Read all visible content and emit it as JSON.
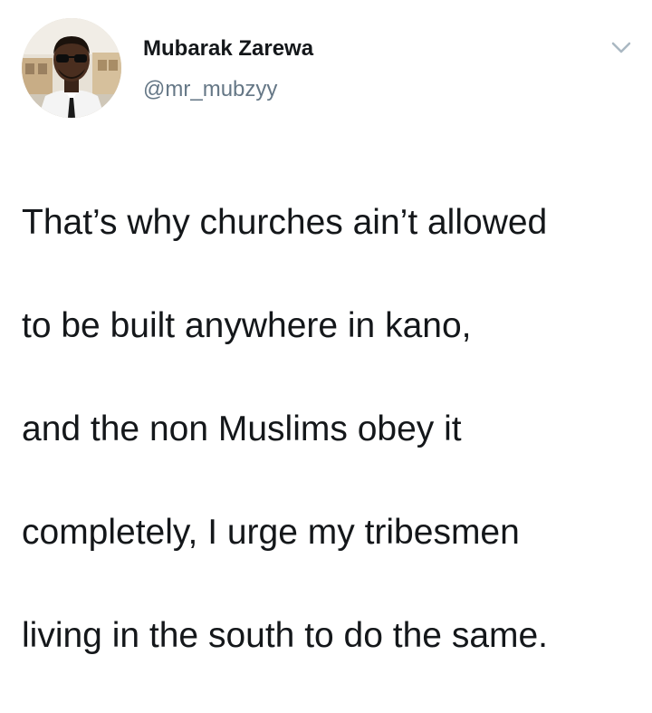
{
  "tweet": {
    "author": {
      "display_name": "Mubarak Zarewa",
      "handle": "@mr_mubzyy",
      "avatar_icon": "profile-photo"
    },
    "menu_icon": "chevron-down-icon",
    "text_lines": [
      "That’s why churches ain’t allowed",
      "to be built anywhere in kano,",
      "and the non Muslims obey it",
      "completely, I urge my tribesmen",
      "living in the south to do the same."
    ]
  },
  "colors": {
    "text": "#14171a",
    "secondary_text": "#657786",
    "caret": "#aab8c2",
    "background": "#ffffff"
  }
}
